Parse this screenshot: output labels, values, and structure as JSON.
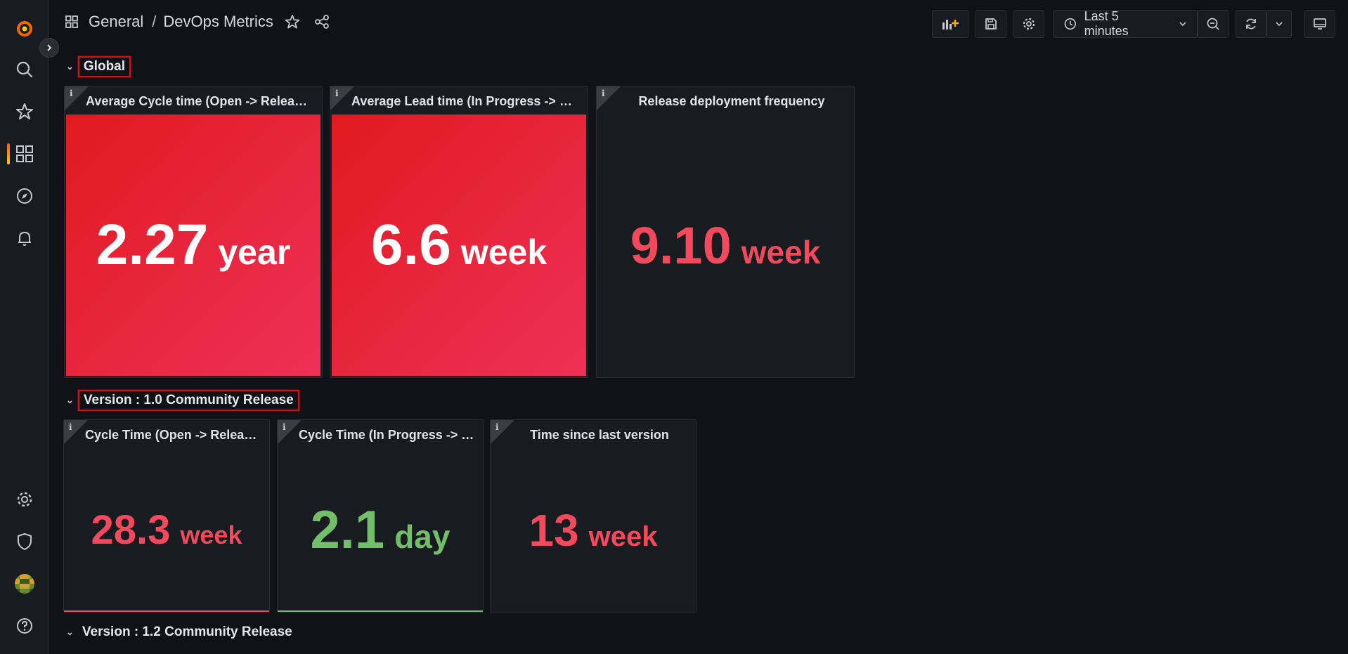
{
  "breadcrumb": {
    "folder": "General",
    "separator": "/",
    "dashboard": "DevOps Metrics"
  },
  "toolbar": {
    "time_range": "Last 5 minutes"
  },
  "colors": {
    "red": "#f2495c",
    "green": "#73bf69",
    "red_bg": "#e11a1f"
  },
  "rows": [
    {
      "title": "Global"
    },
    {
      "title": "Version : 1.0 Community Release"
    },
    {
      "title": "Version : 1.2 Community Release"
    }
  ],
  "global_panels": [
    {
      "title": "Average Cycle time (Open -> Released)",
      "value": "2.27",
      "unit": "year"
    },
    {
      "title": "Average Lead time (In Progress -> Rele...",
      "value": "6.6",
      "unit": "week"
    },
    {
      "title": "Release deployment frequency",
      "value": "9.10",
      "unit": "week"
    }
  ],
  "v10_panels": [
    {
      "title": "Cycle Time (Open -> Released)",
      "value": "28.3",
      "unit": "week"
    },
    {
      "title": "Cycle Time (In Progress -> Re...",
      "value": "2.1",
      "unit": "day"
    },
    {
      "title": "Time since last version",
      "value": "13",
      "unit": "week"
    }
  ],
  "panel_info_glyph": "i",
  "icons": [
    "grafana-logo-icon",
    "search-icon",
    "star-icon",
    "dashboards-icon",
    "explore-icon",
    "alerting-icon",
    "gear-icon",
    "shield-icon",
    "help-icon",
    "share-icon",
    "add-panel-icon",
    "save-icon",
    "settings-icon",
    "clock-icon",
    "zoom-out-icon",
    "refresh-icon",
    "tv-icon"
  ]
}
